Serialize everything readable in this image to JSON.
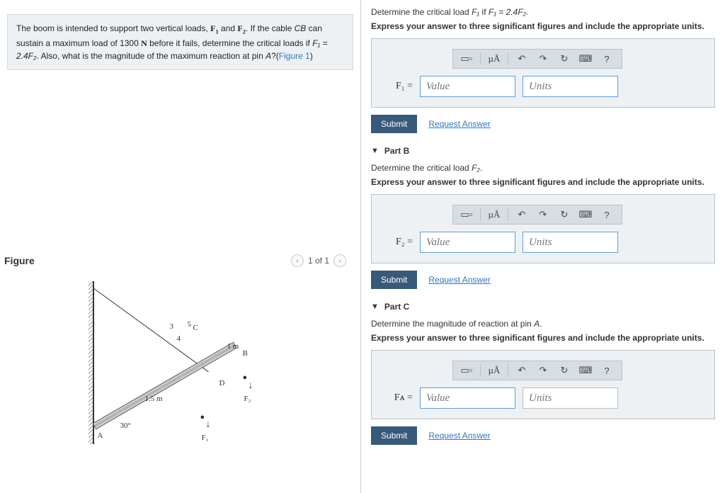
{
  "problem": {
    "text_a": "The boom is intended to support two vertical loads, ",
    "f1": "F",
    "f1sub": "1",
    "and": " and ",
    "f2": "F",
    "f2sub": "2",
    "text_b": ". If the cable ",
    "cb": "CB",
    "text_c": " can sustain a maximum load of 1300 ",
    "n": "N",
    "text_d": " before it fails, determine the critical loads if ",
    "eq": "F₁ = 2.4F₂",
    "text_e": ". Also, what is the magnitude of the maximum reaction at pin ",
    "apin": "A",
    "text_f": "?(",
    "figlink": "Figure 1",
    "text_g": ")"
  },
  "figure": {
    "title": "Figure",
    "counter": "1 of 1",
    "dim_15m": "1.5 m",
    "dim_1m": "1 m",
    "ang": "30°",
    "labels": {
      "A": "A",
      "B": "B",
      "C": "C",
      "D": "D",
      "F1": "F₁",
      "F2": "F₂",
      "n3": "3",
      "n4": "4",
      "n5": "5"
    }
  },
  "partA": {
    "prompt_a": "Determine the critical load ",
    "var": "F₁",
    "prompt_b": " if ",
    "eq": "F₁ = 2.4F₂",
    "prompt_c": ".",
    "instr": "Express your answer to three significant figures and include the appropriate units.",
    "label": "F₁ =",
    "value_ph": "Value",
    "units_ph": "Units",
    "submit": "Submit",
    "request": "Request Answer"
  },
  "partB": {
    "header": "Part B",
    "prompt_a": "Determine the critical load ",
    "var": "F₂",
    "prompt_b": ".",
    "instr": "Express your answer to three significant figures and include the appropriate units.",
    "label": "F₂ =",
    "value_ph": "Value",
    "units_ph": "Units",
    "submit": "Submit",
    "request": "Request Answer"
  },
  "partC": {
    "header": "Part C",
    "prompt_a": "Determine the magnitude of reaction at pin ",
    "var": "A",
    "prompt_b": ".",
    "instr": "Express your answer to three significant figures and include the appropriate units.",
    "label": "Fᴀ =",
    "value_ph": "Value",
    "units_ph": "Units",
    "submit": "Submit",
    "request": "Request Answer"
  },
  "toolbar": {
    "mu": "µÅ",
    "undo": "↶",
    "redo": "↷",
    "reset": "↻",
    "kb": "⌨",
    "help": "?"
  }
}
